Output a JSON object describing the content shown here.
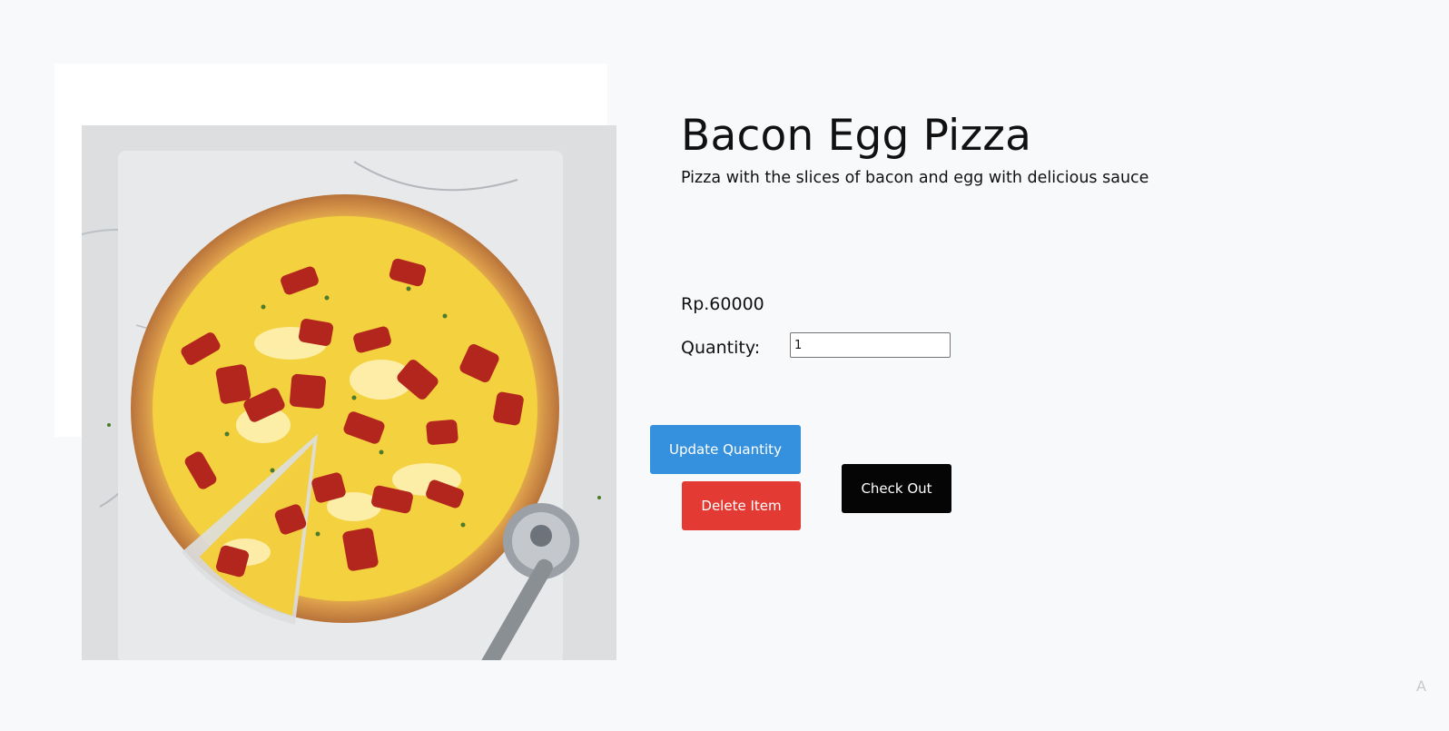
{
  "product": {
    "name": "Bacon Egg Pizza",
    "description": "Pizza with the slices of bacon and egg with delicious sauce",
    "price": "Rp.60000",
    "image_subject": "pizza-with-bacon-and-egg"
  },
  "quantity": {
    "label": "Quantity:",
    "value": "1"
  },
  "actions": {
    "update_label": "Update Quantity",
    "delete_label": "Delete Item",
    "checkout_label": "Check Out"
  },
  "watermark": {
    "text": "A"
  },
  "colors": {
    "update_button": "#3590de",
    "delete_button": "#e33a33",
    "checkout_button": "#050505",
    "page_background": "#f8f9fb"
  }
}
